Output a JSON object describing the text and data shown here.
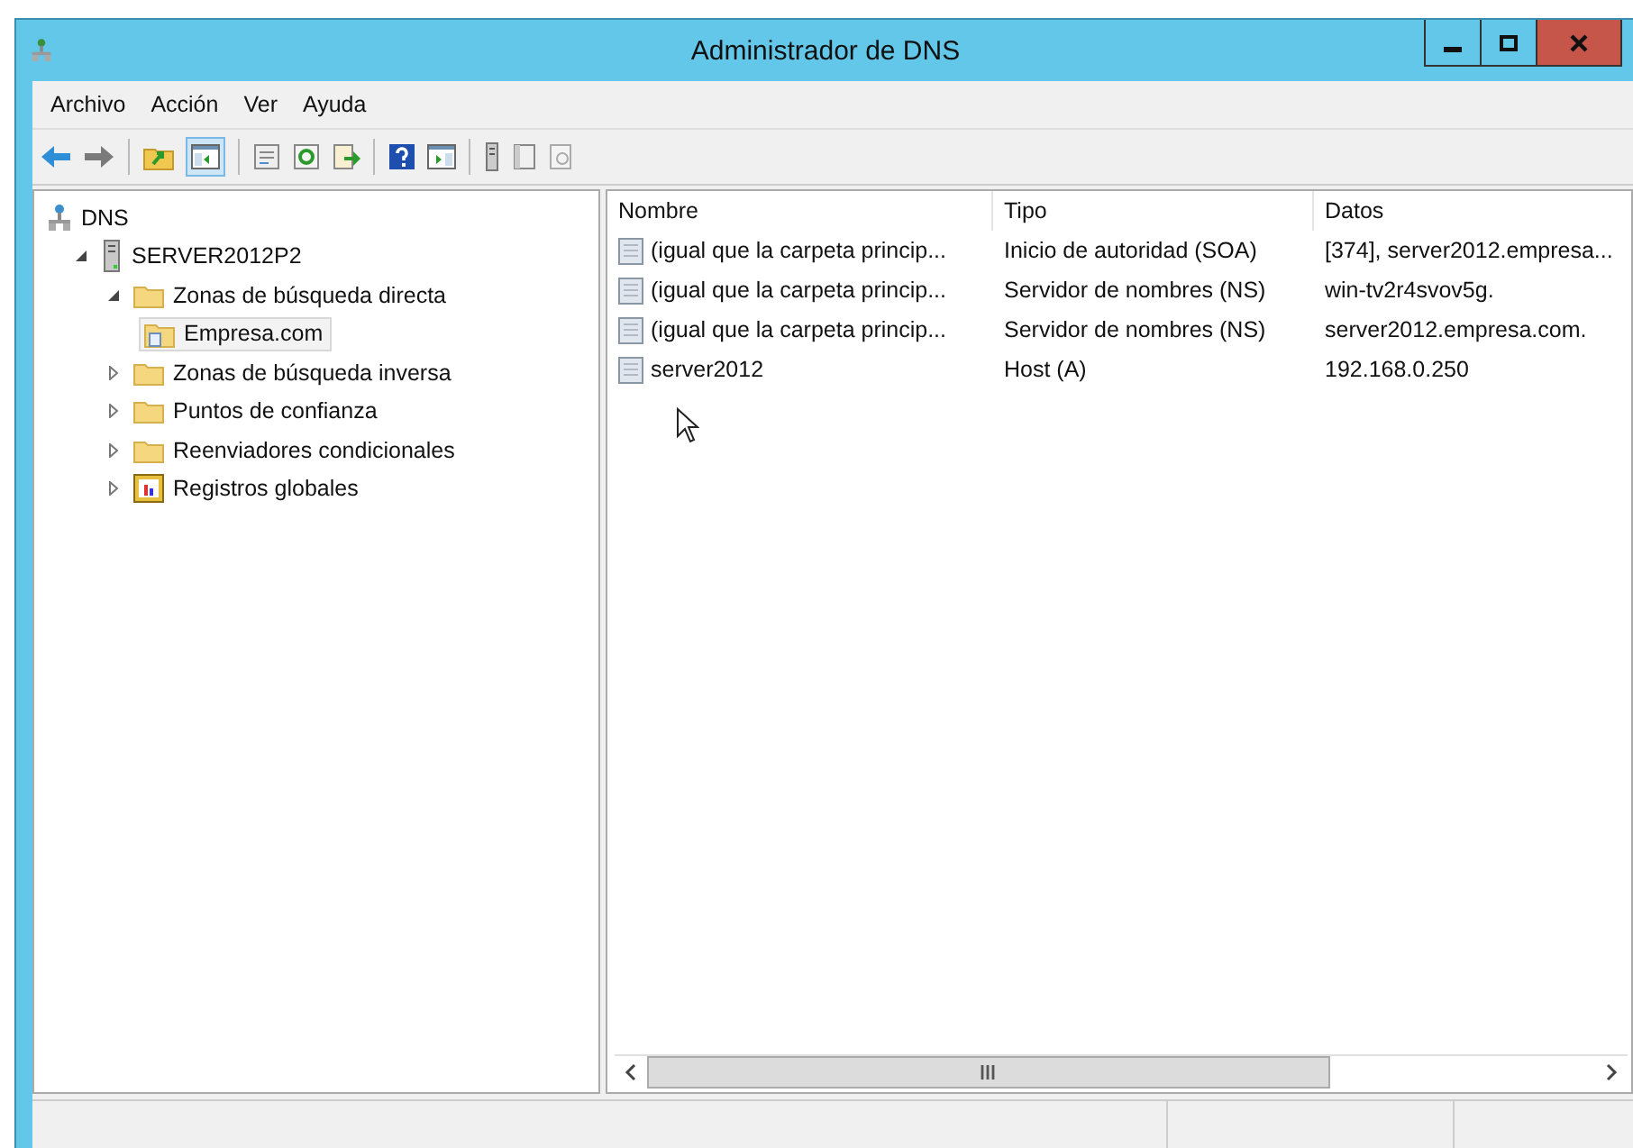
{
  "window": {
    "title": "Administrador de DNS"
  },
  "menu": [
    "Archivo",
    "Acción",
    "Ver",
    "Ayuda"
  ],
  "toolbar": [
    {
      "kind": "back"
    },
    {
      "kind": "forward"
    },
    {
      "kind": "sep"
    },
    {
      "kind": "up"
    },
    {
      "kind": "panel",
      "selected": true
    },
    {
      "kind": "sep"
    },
    {
      "kind": "props"
    },
    {
      "kind": "refresh"
    },
    {
      "kind": "export"
    },
    {
      "kind": "sep"
    },
    {
      "kind": "help"
    },
    {
      "kind": "panel2"
    },
    {
      "kind": "sep"
    },
    {
      "kind": "server"
    },
    {
      "kind": "doc"
    },
    {
      "kind": "doc2"
    }
  ],
  "tree": [
    {
      "label": "DNS",
      "kind": "dns",
      "selected": false,
      "children": [
        {
          "label": "SERVER2012P2",
          "kind": "server",
          "expanded": true,
          "selected": false,
          "children": [
            {
              "label": "Zonas de búsqueda directa",
              "kind": "folder",
              "expanded": true,
              "selected": false,
              "children": [
                {
                  "label": "Empresa.com",
                  "kind": "zone",
                  "selected": true
                }
              ]
            },
            {
              "label": "Zonas de búsqueda inversa",
              "kind": "folder",
              "expanded": false,
              "selected": false
            },
            {
              "label": "Puntos de confianza",
              "kind": "folder",
              "expanded": false,
              "selected": false
            },
            {
              "label": "Reenviadores condicionales",
              "kind": "folder",
              "expanded": false,
              "selected": false
            },
            {
              "label": "Registros globales",
              "kind": "global",
              "expanded": false,
              "selected": false
            }
          ]
        }
      ]
    }
  ],
  "table": {
    "columns": [
      "Nombre",
      "Tipo",
      "Datos"
    ],
    "rows": [
      [
        "(igual que la carpeta princip...",
        "Inicio de autoridad (SOA)",
        "[374], server2012.empresa..."
      ],
      [
        "(igual que la carpeta princip...",
        "Servidor de nombres (NS)",
        "win-tv2r4svov5g."
      ],
      [
        "(igual que la carpeta princip...",
        "Servidor de nombres (NS)",
        "server2012.empresa.com."
      ],
      [
        "server2012",
        "Host (A)",
        "192.168.0.250"
      ]
    ]
  }
}
